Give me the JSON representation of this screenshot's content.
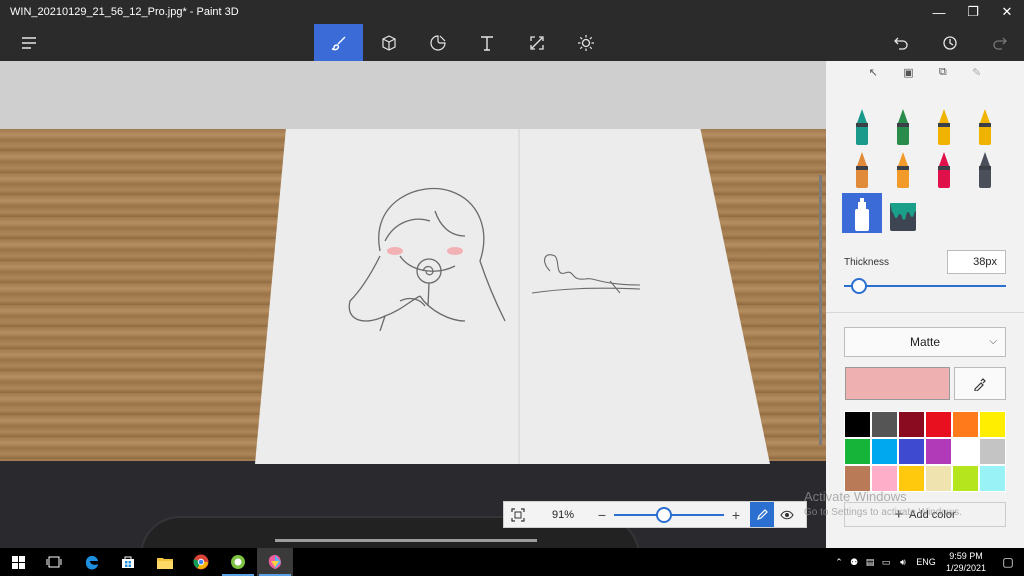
{
  "window": {
    "title": "WIN_20210129_21_56_12_Pro.jpg* - Paint 3D"
  },
  "toolbar": {
    "tools": [
      {
        "name": "brushes",
        "icon": "brush-icon",
        "active": true
      },
      {
        "name": "3d-shapes",
        "icon": "cube-icon"
      },
      {
        "name": "stickers",
        "icon": "sticker-icon"
      },
      {
        "name": "text",
        "icon": "text-icon"
      },
      {
        "name": "canvas",
        "icon": "canvas-resize-icon"
      },
      {
        "name": "effects",
        "icon": "effects-sun-icon"
      }
    ],
    "right": [
      "undo-icon",
      "history-icon",
      "redo-icon"
    ]
  },
  "zoom": {
    "percent": "91%",
    "level": 0.45
  },
  "panel": {
    "selection_tools": [
      "select-icon",
      "crop-icon",
      "copy-icon",
      "edit-icon"
    ],
    "brushes": [
      {
        "name": "marker",
        "color": "#1a9a8a"
      },
      {
        "name": "calligraphy-pen",
        "color": "#2a8c4a"
      },
      {
        "name": "oil-brush",
        "color": "#f0b400"
      },
      {
        "name": "watercolor",
        "color": "#f0b400"
      },
      {
        "name": "pixel-pen",
        "color": "#e08a3a"
      },
      {
        "name": "pencil",
        "color": "#f29a2a"
      },
      {
        "name": "eraser",
        "color": "#e0104a"
      },
      {
        "name": "crayon",
        "color": "#4a4f5a"
      },
      {
        "name": "spray-can",
        "color": "#ffffff",
        "active": true
      },
      {
        "name": "fill",
        "color": "#1aa08a"
      }
    ],
    "thickness_label": "Thickness",
    "thickness_value": "38px",
    "thickness_level": 0.05,
    "material": "Matte",
    "current_color": "#eeb0b0",
    "palette": [
      "#000000",
      "#555555",
      "#8a0b1f",
      "#e8101f",
      "#ff7a1a",
      "#ffee00",
      "#17b43a",
      "#00a8ef",
      "#3e4bd1",
      "#b03ab8",
      "#ffffff",
      "#c4c4c4",
      "#b97a57",
      "#ffaec9",
      "#ffc90e",
      "#efe4b0",
      "#b5e61d",
      "#99f3f6"
    ],
    "add_color": "Add color"
  },
  "watermark": {
    "line1": "Activate Windows",
    "line2": "Go to Settings to activate Windows."
  },
  "taskbar": {
    "apps": [
      "windows-start-icon",
      "task-view-icon",
      "edge-icon",
      "store-icon",
      "file-explorer-icon",
      "chrome-icon",
      "greenshot-icon",
      "paint-3d-icon"
    ],
    "language": "ENG",
    "time": "9:59 PM",
    "date": "1/29/2021"
  }
}
